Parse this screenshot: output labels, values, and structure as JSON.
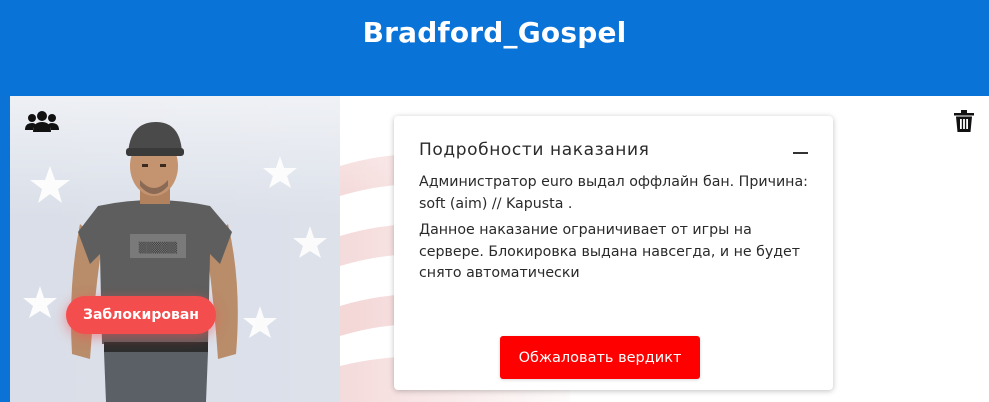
{
  "header": {
    "title": "Bradford_Gospel"
  },
  "colors": {
    "header_bg": "#0a73d7",
    "badge_bg": "#f44d4d",
    "button_bg": "#ff0000"
  },
  "icons": {
    "players": "users-icon",
    "delete": "trash-icon",
    "collapse": "minus-icon"
  },
  "player": {
    "status": "Заблокирован"
  },
  "punishment": {
    "title": "Подробности наказания",
    "description": "Администратор euro выдал оффлайн бан. Причина: soft (aim) // Kapusta .",
    "note": "Данное наказание ограничивает от игры на сервере. Блокировка выдана навсегда, и не будет снято автоматически",
    "appeal_label": "Обжаловать вердикт"
  }
}
